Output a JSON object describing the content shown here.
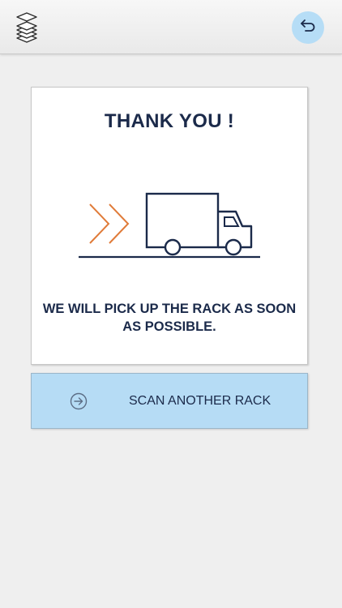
{
  "header": {
    "logo_icon": "stacked-layers-icon",
    "back_icon": "undo-arrow-icon",
    "back_button_color": "#b6ddf6"
  },
  "confirmation": {
    "title": "THANK YOU !",
    "illustration_icon": "delivery-truck-icon",
    "message": "WE WILL PICK UP THE RACK AS SOON AS POSSIBLE."
  },
  "actions": {
    "scan_another_label": "SCAN ANOTHER RACK",
    "scan_another_icon": "arrow-right-circle-icon"
  },
  "colors": {
    "primary_text": "#1b2a4a",
    "accent_orange": "#e07b39",
    "button_blue": "#b6dcf5"
  }
}
